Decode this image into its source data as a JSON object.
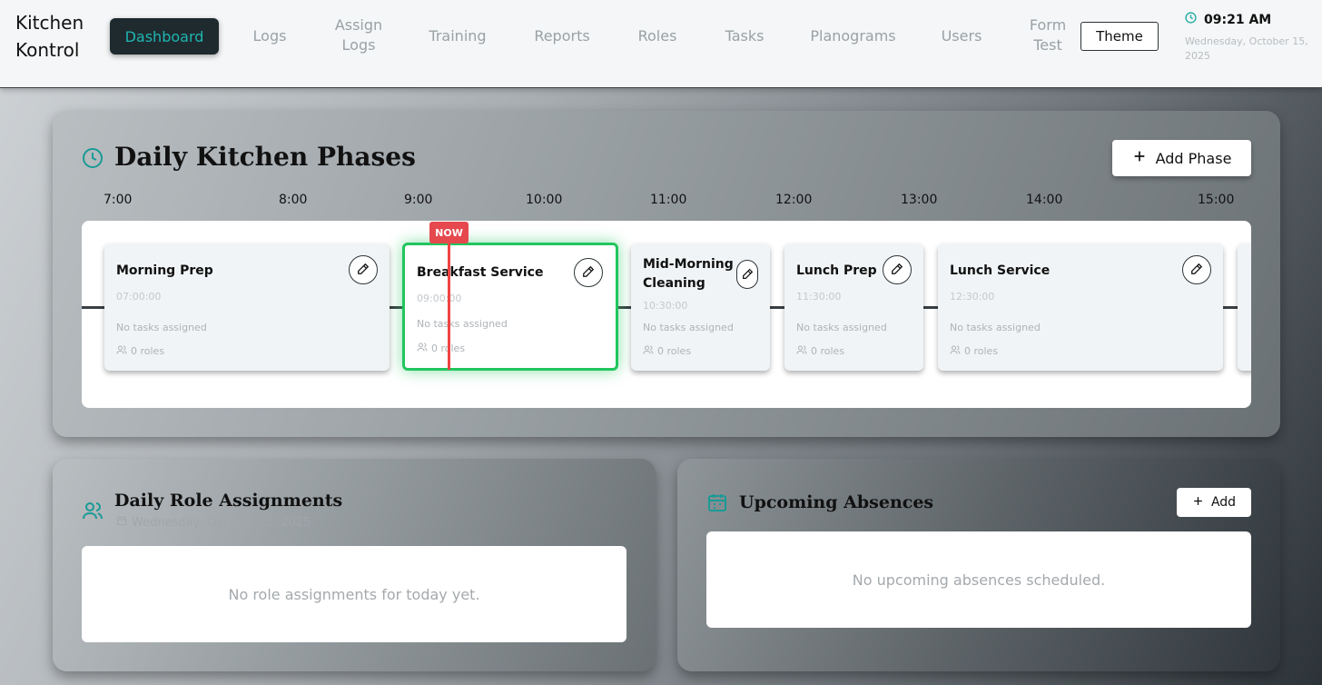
{
  "brand": {
    "line1": "Kitchen",
    "line2": "Kontrol"
  },
  "nav": {
    "active": "Dashboard",
    "items": [
      "Logs",
      "Assign Logs",
      "Training",
      "Reports",
      "Roles",
      "Tasks",
      "Planograms",
      "Users",
      "Form Test"
    ]
  },
  "theme_label": "Theme",
  "clock": {
    "time": "09:21 AM",
    "date": "Wednesday, October 15, 2025"
  },
  "phases_panel": {
    "title": "Daily Kitchen Phases",
    "add_label": "Add Phase",
    "hours": [
      "7:00",
      "8:00",
      "9:00",
      "10:00",
      "11:00",
      "12:00",
      "13:00",
      "14:00",
      "15:00"
    ],
    "now_label": "NOW",
    "phases": [
      {
        "name": "Morning Prep",
        "time": "07:00:00",
        "tasks": "No tasks assigned",
        "roles": "0 roles"
      },
      {
        "name": "Breakfast Service",
        "time": "09:00:00",
        "tasks": "No tasks assigned",
        "roles": "0 roles"
      },
      {
        "name": "Mid-Morning Cleaning",
        "time": "10:30:00",
        "tasks": "No tasks assigned",
        "roles": "0 roles"
      },
      {
        "name": "Lunch Prep",
        "time": "11:30:00",
        "tasks": "No tasks assigned",
        "roles": "0 roles"
      },
      {
        "name": "Lunch Service",
        "time": "12:30:00",
        "tasks": "No tasks assigned",
        "roles": "0 roles"
      }
    ]
  },
  "roles_panel": {
    "title": "Daily Role Assignments",
    "date": "Wednesday, October 15, 2025",
    "empty": "No role assignments for today yet."
  },
  "absences_panel": {
    "title": "Upcoming Absences",
    "add_label": "Add",
    "empty": "No upcoming absences scheduled."
  },
  "colors": {
    "accent": "#1fb6b0",
    "active_phase": "#22c55e",
    "now": "#ef4444"
  }
}
